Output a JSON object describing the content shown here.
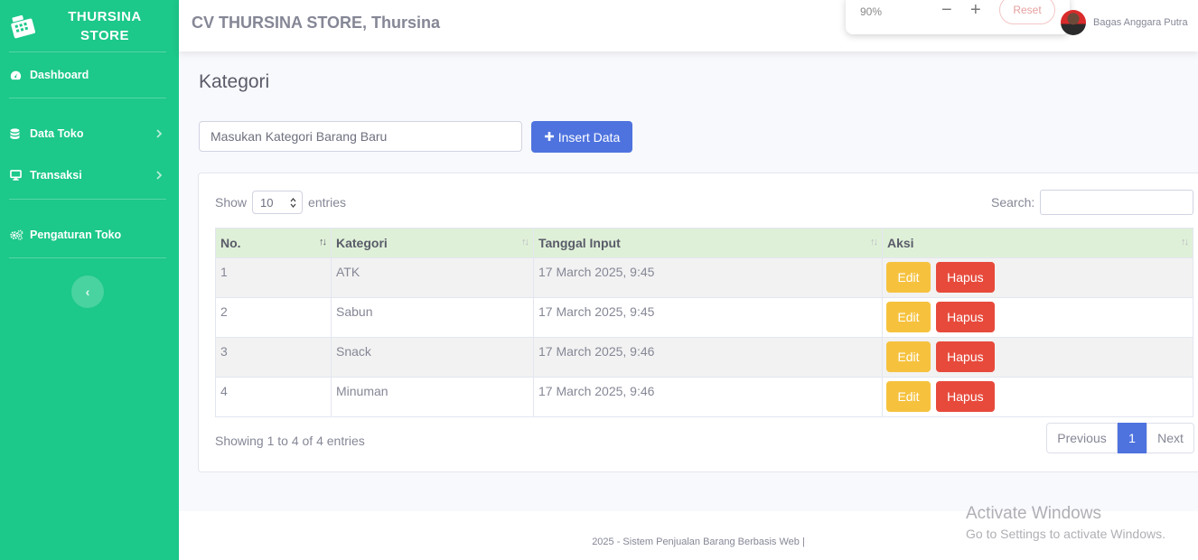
{
  "sidebar": {
    "brand_line1": "THURSINA",
    "brand_line2": "STORE",
    "items": [
      {
        "label": "Dashboard"
      },
      {
        "label": "Data Toko"
      },
      {
        "label": "Transaksi"
      },
      {
        "label": "Pengaturan Toko"
      }
    ],
    "toggle_glyph": "‹"
  },
  "topbar": {
    "store_title": "CV THURSINA STORE, Thursina",
    "zoom_level": "90%",
    "zoom_minus": "−",
    "zoom_plus": "+",
    "zoom_reset": "Reset",
    "user_name": "Bagas Anggara Putra"
  },
  "page": {
    "title": "Kategori",
    "input_placeholder": "Masukan Kategori Barang Baru",
    "insert_label": "Insert Data"
  },
  "table": {
    "show_label": "Show",
    "entries_label": "entries",
    "length_value": "10",
    "search_label": "Search:",
    "columns": [
      "No.",
      "Kategori",
      "Tanggal Input",
      "Aksi"
    ],
    "rows": [
      {
        "no": "1",
        "kategori": "ATK",
        "tanggal": "17 March 2025, 9:45"
      },
      {
        "no": "2",
        "kategori": "Sabun",
        "tanggal": "17 March 2025, 9:45"
      },
      {
        "no": "3",
        "kategori": "Snack",
        "tanggal": "17 March 2025, 9:46"
      },
      {
        "no": "4",
        "kategori": "Minuman",
        "tanggal": "17 March 2025, 9:46"
      }
    ],
    "edit_label": "Edit",
    "hapus_label": "Hapus",
    "info": "Showing 1 to 4 of 4 entries",
    "pager": {
      "previous": "Previous",
      "current": "1",
      "next": "Next"
    }
  },
  "footer": {
    "text": "2025 - Sistem Penjualan Barang Berbasis Web |"
  },
  "watermark": {
    "line1": "Activate Windows",
    "line2": "Go to Settings to activate Windows."
  },
  "colors": {
    "sidebar": "#1cc88a",
    "primary": "#4e73df",
    "warning": "#f6c23e",
    "danger": "#e74a3b",
    "header_row": "#dff0d8"
  }
}
